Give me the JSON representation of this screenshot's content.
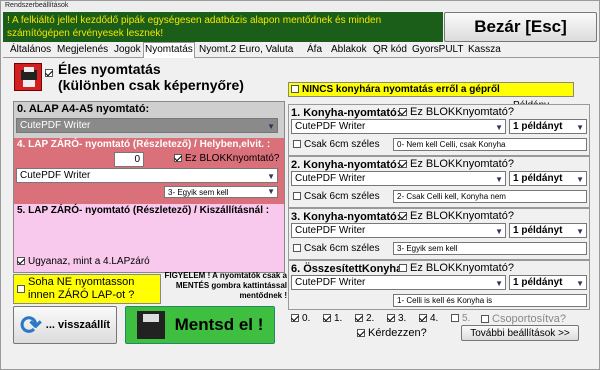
{
  "window": {
    "title": "Rendszerbeállítások"
  },
  "banner": {
    "text": "! A felkiáltó jellel kezdődő pipák egységesen adatbázis alapon mentődnek és minden számítógépen érvényesek lesznek!"
  },
  "close_button": "Bezár [Esc]",
  "tabs": [
    "Általános",
    "Megjelenés",
    "Jogok",
    "Nyomtatás",
    "Nyomt.2",
    "Euro, Valuta",
    "Áfa",
    "Ablakok",
    "QR kód",
    "GyorsPULT",
    "Kassza"
  ],
  "active_tab": "Nyomtatás",
  "live_print": {
    "title": "Éles nyomtatás",
    "subtitle": "(különben csak képernyőre)"
  },
  "sections": {
    "alap": {
      "title": "0. ALAP A4-A5 nyomtató:",
      "printer": "CutePDF Writer"
    },
    "lap_zaro": {
      "title": "4. LAP ZÁRÓ- nyomtató (Részletező) / Helyben,elvit. :",
      "number": "0",
      "blok_label": "Ez BLOKKnyomtató?",
      "printer": "CutePDF Writer",
      "option": "3- Egyik sem kell"
    },
    "kiszallitas": {
      "title": "5. LAP ZÁRÓ- nyomtató (Részletező) / Kiszállításnál :",
      "same_label": "Ugyanaz, mint a 4.LAPzáró"
    }
  },
  "soha_label": "Soha NE nyomtasson innen ZÁRÓ LAP-ot ?",
  "figyelem": "FIGYELEM ! A nyomtatók csak a MENTÉS gombra kattintással mentődnek !",
  "buttons": {
    "restore": "... visszaállít",
    "save": "Mentsd el !",
    "more": "További beállítások >>"
  },
  "right": {
    "no_kitchen": "NINCS konyhára nyomtatás erről a gépről",
    "pieces_header": "Példány",
    "blok_label": "Ez BLOKKnyomtató?",
    "width_label": "Csak 6cm széles",
    "printers": [
      {
        "label": "1. Konyha-nyomtató:",
        "printer": "CutePDF Writer",
        "copies": "1 példányt",
        "option": "0- Nem kell Celli, csak Konyha"
      },
      {
        "label": "2. Konyha-nyomtató:",
        "printer": "CutePDF Writer",
        "copies": "1 példányt",
        "option": "2- Csak Celli kell, Konyha nem"
      },
      {
        "label": "3. Konyha-nyomtató:",
        "printer": "CutePDF Writer",
        "copies": "1 példányt",
        "option": "3- Egyik sem kell"
      },
      {
        "label": "6. ÖsszesítettKonyha",
        "printer": "CutePDF Writer",
        "copies": "1 példányt",
        "option": "1- Celli is kell és Konyha is"
      }
    ],
    "numbers": [
      "0.",
      "1.",
      "2.",
      "3.",
      "4.",
      "5."
    ],
    "grouping": "Csoportosítva?",
    "ask": "Kérdezzen?"
  }
}
